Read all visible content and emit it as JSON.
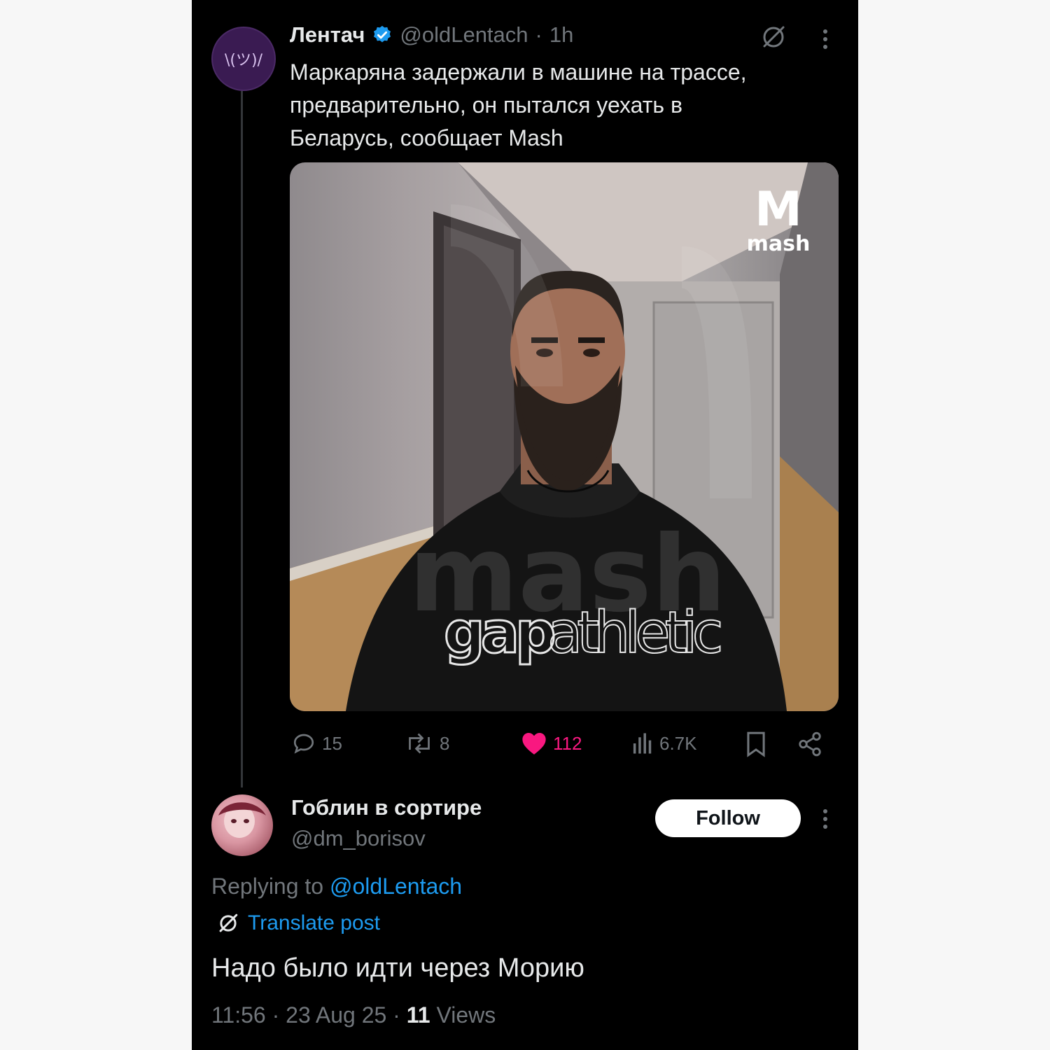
{
  "post": {
    "author_name": "Лентач",
    "verified_icon": "verified-badge-icon",
    "handle": "@oldLentach",
    "separator": "·",
    "time": "1h",
    "avatar_text": "\\(ツ)/",
    "text_lines": [
      "Маркаряна задержали в машине на трассе,",
      "предварительно, он пытался уехать в",
      "Беларусь, сообщает Mash"
    ],
    "image": {
      "watermark_logo_letter": "M",
      "watermark_logo_text": "mash",
      "watermark_center_text": "mash",
      "shirt_text_bold": "gap",
      "shirt_text_light": "athletic"
    },
    "actions": {
      "replies": "15",
      "reposts": "8",
      "likes": "112",
      "views": "6.7K"
    }
  },
  "reply": {
    "author_name": "Гоблин в сортире",
    "handle": "@dm_borisov",
    "follow_label": "Follow",
    "replying_prefix": "Replying to ",
    "replying_handle": "@oldLentach",
    "translate_label": "Translate post",
    "text": "Надо было идти через Морию",
    "time": "11:56",
    "date": "23 Aug 25",
    "separator": "·",
    "views_count": "11",
    "views_label": "Views"
  },
  "colors": {
    "background": "#000000",
    "accent": "#1d9bf0",
    "like": "#f91880",
    "secondary_text": "#71767b"
  }
}
